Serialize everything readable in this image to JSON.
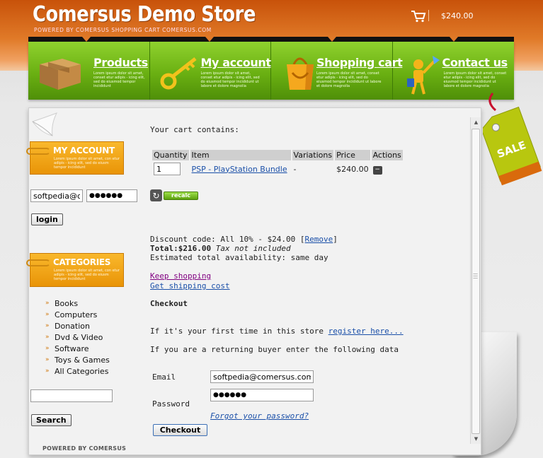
{
  "header": {
    "title": "Comersus Demo Store",
    "subtitle": "POWERED BY COMERSUS SHOPPING CART COMERSUS.COM",
    "cart_total": "$240.00"
  },
  "nav": {
    "items": [
      {
        "label": "Products",
        "desc": "Lorem ipsum dolor sit amet, conset etur adipis - icing elit, sed do eiusmod tempor incididunt"
      },
      {
        "label": "My account",
        "desc": "Lorem ipsum dolor sit amet, conset etur adipis - icing elit, sed do eiusmod tempor incididunt ut labore et dolore magnolia"
      },
      {
        "label": "Shopping cart",
        "desc": "Lorem ipsum dolor sit amet, conset etur adipis - icing elit, sed do eiusmod tempor incididunt ut labore et dolore magnolia"
      },
      {
        "label": "Contact us",
        "desc": "Lorem ipsum dolor sit amet, conset etur adipis - icing elit, sed do eiusmod tempor incididunt ut labore et dolore magnolia"
      }
    ]
  },
  "sidebar": {
    "account_box": {
      "label": "MY ACCOUNT",
      "desc": "Lorem ipsum dolor sit amet, con etur adipis - icing elit, sed do eiusm tempor incididunt"
    },
    "login_email": "softpedia@comersus.com",
    "login_password": "●●●●●●",
    "login_button": "login",
    "categories_box": {
      "label": "CATEGORIES",
      "desc": "Lorem ipsum dolor sit amet, con etur adipis - icing elit, sed do eiusm tempor incididunt"
    },
    "categories": [
      "Books",
      "Computers",
      "Donation",
      "Dvd & Video",
      "Software",
      "Toys & Games",
      "All Categories"
    ],
    "search_value": "",
    "search_button": "Search",
    "powered_by": "POWERED BY COMERSUS"
  },
  "cart": {
    "heading": "Your cart contains:",
    "columns": [
      "Quantity",
      "Item",
      "Variations",
      "Price",
      "Actions"
    ],
    "rows": [
      {
        "quantity": "1",
        "item": "PSP - PlayStation Bundle",
        "variations": "-",
        "price": "$240.00"
      }
    ],
    "recalc_label": "recalc",
    "discount_prefix": "Discount code: All 10% - $24.00 [",
    "discount_remove": "Remove",
    "discount_suffix": "]",
    "total_label": "Total:$216.00",
    "tax_note": "Tax not included",
    "availability": "Estimated total availability: same day",
    "keep_shopping": "Keep shopping",
    "shipping_cost": "Get shipping cost"
  },
  "checkout": {
    "title": "Checkout",
    "first_time_text": "If it's your first time in this store",
    "register_link": "register here...",
    "returning_text": "If you are a returning buyer enter the following data",
    "email_label": "Email",
    "email_value": "softpedia@comersus.com",
    "password_label": "Password",
    "password_value": "●●●●●●",
    "forgot_link": "Forgot your password?",
    "checkout_button": "Checkout"
  },
  "badge": {
    "sale": "SALE"
  },
  "colors": {
    "header_orange": "#d9660f",
    "nav_green": "#6ab012",
    "box_orange": "#f0a318",
    "link_blue": "#1a4fa8"
  }
}
